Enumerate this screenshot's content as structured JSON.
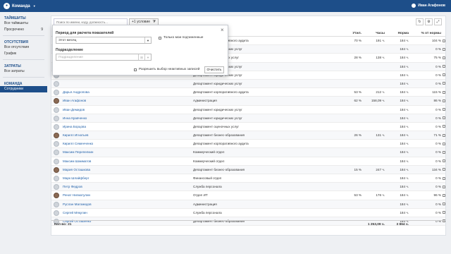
{
  "topbar": {
    "app_name": "Команда",
    "user_name": "Иван Агафонов"
  },
  "sidebar": {
    "sections": [
      {
        "title": "ТАЙМШИТЫ",
        "items": [
          {
            "label": "Все таймшиты",
            "count": ""
          },
          {
            "label": "Просрочено",
            "count": "9"
          }
        ]
      },
      {
        "title": "ОТСУТСТВИЯ",
        "items": [
          {
            "label": "Все отсутствия",
            "count": ""
          },
          {
            "label": "График",
            "count": ""
          }
        ]
      },
      {
        "title": "ЗАТРАТЫ",
        "items": [
          {
            "label": "Все затраты",
            "count": ""
          }
        ]
      },
      {
        "title": "КОМАНДА",
        "items": [
          {
            "label": "Сотрудники",
            "count": "",
            "active": true
          }
        ]
      }
    ]
  },
  "toolbar": {
    "search_placeholder": "Поиск по имени, коду, должность...",
    "conditions_label": "+1 условие",
    "filter_icon": "filter-icon",
    "refresh_icon": "refresh-icon",
    "settings_icon": "gear-icon",
    "expand_icon": "expand-icon"
  },
  "table": {
    "headers": {
      "util": "Утил.",
      "hours": "Часы",
      "norm": "Норма",
      "eff": "% от нормы"
    },
    "rows": [
      {
        "name": "",
        "dept": "Департамент корпоративного аудита",
        "util": "70 %",
        "hours": "191 ч.",
        "norm": "184 ч.",
        "eff": "104 %",
        "avatar": "default"
      },
      {
        "name": "",
        "dept": "Департамент юридических услуг",
        "util": "",
        "hours": "",
        "norm": "184 ч.",
        "eff": "0 %",
        "avatar": "default"
      },
      {
        "name": "",
        "dept": "Департамент оценочных услуг",
        "util": "28 %",
        "hours": "138 ч.",
        "norm": "184 ч.",
        "eff": "75 %",
        "avatar": "default"
      },
      {
        "name": "",
        "dept": "Департамент юридических услуг",
        "util": "",
        "hours": "",
        "norm": "184 ч.",
        "eff": "0 %",
        "avatar": "default"
      },
      {
        "name": "",
        "dept": "Департамент юридических услуг",
        "util": "",
        "hours": "",
        "norm": "184 ч.",
        "eff": "0 %",
        "avatar": "default"
      },
      {
        "name": "",
        "dept": "Департамент юридических услуг",
        "util": "",
        "hours": "",
        "norm": "184 ч.",
        "eff": "0 %",
        "avatar": "default"
      },
      {
        "name": "Дарья Андропова",
        "dept": "Департамент корпоративного аудита",
        "util": "53 %",
        "hours": "212 ч.",
        "norm": "184 ч.",
        "eff": "115 %",
        "avatar": "default"
      },
      {
        "name": "Иван Агафонов",
        "dept": "Администрация",
        "util": "62 %",
        "hours": "158,09 ч.",
        "norm": "184 ч.",
        "eff": "86 %",
        "avatar": "photo"
      },
      {
        "name": "Иван Демидов",
        "dept": "Департамент юридических услуг",
        "util": "",
        "hours": "",
        "norm": "184 ч.",
        "eff": "0 %",
        "avatar": "default"
      },
      {
        "name": "Инна Кравченко",
        "dept": "Департамент юридических услуг",
        "util": "",
        "hours": "",
        "norm": "184 ч.",
        "eff": "0 %",
        "avatar": "default"
      },
      {
        "name": "Ирина Борцова",
        "dept": "Департамент оценочных услуг",
        "util": "",
        "hours": "",
        "norm": "184 ч.",
        "eff": "0 %",
        "avatar": "default"
      },
      {
        "name": "Кирилл Игнатьев",
        "dept": "Департамент бизнес-образования",
        "util": "26 %",
        "hours": "131 ч.",
        "norm": "184 ч.",
        "eff": "71 %",
        "avatar": "photo"
      },
      {
        "name": "Кирилл Семенченко",
        "dept": "Департамент корпоративного аудита",
        "util": "",
        "hours": "",
        "norm": "184 ч.",
        "eff": "0 %",
        "avatar": "default"
      },
      {
        "name": "Максим Перепелкин",
        "dept": "Коммерческий отдел",
        "util": "",
        "hours": "",
        "norm": "184 ч.",
        "eff": "0 %",
        "avatar": "default"
      },
      {
        "name": "Максим Шамматов",
        "dept": "Коммерческий отдел",
        "util": "",
        "hours": "",
        "norm": "184 ч.",
        "eff": "0 %",
        "avatar": "default"
      },
      {
        "name": "Мария Осташкова",
        "dept": "Департамент бизнес-образования",
        "util": "15 %",
        "hours": "247 ч.",
        "norm": "184 ч.",
        "eff": "134 %",
        "avatar": "photo"
      },
      {
        "name": "Марк Шлайфберг",
        "dept": "Финансовый отдел",
        "util": "",
        "hours": "",
        "norm": "184 ч.",
        "eff": "0 %",
        "avatar": "default"
      },
      {
        "name": "Петр Федров",
        "dept": "Служба персонала",
        "util": "",
        "hours": "",
        "norm": "184 ч.",
        "eff": "0 %",
        "avatar": "default"
      },
      {
        "name": "Ренат Нигматулин",
        "dept": "Отдел ИТ",
        "util": "53 %",
        "hours": "176 ч.",
        "norm": "184 ч.",
        "eff": "96 %",
        "avatar": "photo"
      },
      {
        "name": "Руслан Магомедов",
        "dept": "Администрация",
        "util": "",
        "hours": "",
        "norm": "184 ч.",
        "eff": "0 %",
        "avatar": "default"
      },
      {
        "name": "Сергей Мякулин",
        "dept": "Служба персонала",
        "util": "",
        "hours": "",
        "norm": "184 ч.",
        "eff": "0 %",
        "avatar": "default"
      },
      {
        "name": "Сергей Осташенко",
        "dept": "Департамент бизнес-образования",
        "util": "",
        "hours": "",
        "norm": "184 ч.",
        "eff": "0 %",
        "avatar": "default"
      }
    ],
    "footer": {
      "count_label": "Кол-во: 21",
      "hours_total": "1 253,09 ч.",
      "norm_total": "3 864 ч."
    }
  },
  "filter_panel": {
    "period_label": "Период для расчета показателей",
    "period_value": "Этот месяц",
    "only_subordinates": "Только мои подчиненные",
    "department_label": "Подразделение",
    "department_placeholder": "Подразделение",
    "allow_inactive": "Разрешить выбор неактивных записей",
    "clear_button": "Очистить",
    "close_icon": "close-icon"
  }
}
